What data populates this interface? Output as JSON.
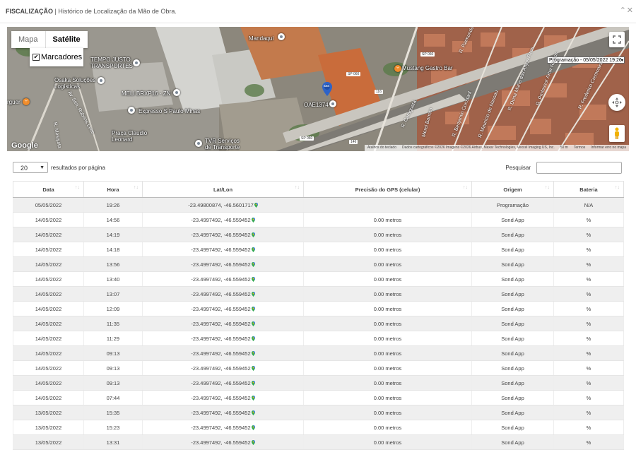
{
  "title": {
    "module": "FISCALIZAÇÃO",
    "separator": " | ",
    "subtitle": "Histórico de Localização da Mão de Obra."
  },
  "window": {
    "collapse_glyph": "⌃",
    "close_glyph": "✕"
  },
  "map": {
    "type_buttons": {
      "map": "Mapa",
      "satellite": "Satélite"
    },
    "markers_label": "Marcadores",
    "markers_checked": "✔",
    "select_value": "Programação - 05/05/2022 19:26",
    "select_arrow": "▾",
    "pin_label": "SEN",
    "pois": [
      {
        "name": "Mandaqui"
      },
      {
        "name": "TEMPO JUSTO\nTRANSPORTES"
      },
      {
        "name": "Osaka Soluções\nLogísticas"
      },
      {
        "name": "MELI BRXP16 - ZN"
      },
      {
        "name": "Expresso S Paulo Minas"
      },
      {
        "name": "Praça Claudio\nLeonard"
      },
      {
        "name": "TVR Serviços\nde Transporte"
      },
      {
        "name": "OAE1374"
      },
      {
        "name": "Mustang Gastro Bar"
      },
      {
        "name": "rguer"
      }
    ],
    "streets": [
      "R. Mesquita",
      "Av. Sen. Rubens Leite",
      "R. Caraguatá",
      "R. Benjamin Constant",
      "R. Mauricio de Nassau",
      "R. Dona Maria dos Anjos Pires",
      "R. Professor Artur Ramos",
      "R. Frederico Cremonini",
      "Merei Barreto",
      "R. Raimundo Ro"
    ],
    "shields": [
      "SP 060",
      "SP 060",
      "116",
      "146",
      "SP 060"
    ],
    "google": "Google",
    "attribution": [
      "Atalhos do teclado",
      "Dados cartográficos ©2026 Imagens ©2026 Airbus, Maxar Technologies, Vexcel Imaging US, Inc.",
      "50 m",
      "Termos",
      "Informar erro no mapa"
    ],
    "icons": {
      "fullscreen": "fullscreen-icon",
      "pan": "pan-control-icon",
      "pegman": "pegman-icon"
    }
  },
  "table_controls": {
    "page_length": "20",
    "page_length_suffix": "resultados por página",
    "search_label": "Pesquisar",
    "sort_glyph": "↑↓"
  },
  "columns": [
    "Data",
    "Hora",
    "Lat/Lon",
    "Precisão do GPS (celular)",
    "Origem",
    "Bateria"
  ],
  "rows": [
    {
      "data": "05/05/2022",
      "hora": "19:26",
      "latlon": "-23.49800874, -46.5601717",
      "gps": "",
      "origem": "Programação",
      "bateria": "N/A"
    },
    {
      "data": "14/05/2022",
      "hora": "14:56",
      "latlon": "-23.4997492, -46.559452",
      "gps": "0.00 metros",
      "origem": "Sond App",
      "bateria": "%"
    },
    {
      "data": "14/05/2022",
      "hora": "14:19",
      "latlon": "-23.4997492, -46.559452",
      "gps": "0.00 metros",
      "origem": "Sond App",
      "bateria": "%"
    },
    {
      "data": "14/05/2022",
      "hora": "14:18",
      "latlon": "-23.4997492, -46.559452",
      "gps": "0.00 metros",
      "origem": "Sond App",
      "bateria": "%"
    },
    {
      "data": "14/05/2022",
      "hora": "13:56",
      "latlon": "-23.4997492, -46.559452",
      "gps": "0.00 metros",
      "origem": "Sond App",
      "bateria": "%"
    },
    {
      "data": "14/05/2022",
      "hora": "13:40",
      "latlon": "-23.4997492, -46.559452",
      "gps": "0.00 metros",
      "origem": "Sond App",
      "bateria": "%"
    },
    {
      "data": "14/05/2022",
      "hora": "13:07",
      "latlon": "-23.4997492, -46.559452",
      "gps": "0.00 metros",
      "origem": "Sond App",
      "bateria": "%"
    },
    {
      "data": "14/05/2022",
      "hora": "12:09",
      "latlon": "-23.4997492, -46.559452",
      "gps": "0.00 metros",
      "origem": "Sond App",
      "bateria": "%"
    },
    {
      "data": "14/05/2022",
      "hora": "11:35",
      "latlon": "-23.4997492, -46.559452",
      "gps": "0.00 metros",
      "origem": "Sond App",
      "bateria": "%"
    },
    {
      "data": "14/05/2022",
      "hora": "11:29",
      "latlon": "-23.4997492, -46.559452",
      "gps": "0.00 metros",
      "origem": "Sond App",
      "bateria": "%"
    },
    {
      "data": "14/05/2022",
      "hora": "09:13",
      "latlon": "-23.4997492, -46.559452",
      "gps": "0.00 metros",
      "origem": "Sond App",
      "bateria": "%"
    },
    {
      "data": "14/05/2022",
      "hora": "09:13",
      "latlon": "-23.4997492, -46.559452",
      "gps": "0.00 metros",
      "origem": "Sond App",
      "bateria": "%"
    },
    {
      "data": "14/05/2022",
      "hora": "09:13",
      "latlon": "-23.4997492, -46.559452",
      "gps": "0.00 metros",
      "origem": "Sond App",
      "bateria": "%"
    },
    {
      "data": "14/05/2022",
      "hora": "07:44",
      "latlon": "-23.4997492, -46.559452",
      "gps": "0.00 metros",
      "origem": "Sond App",
      "bateria": "%"
    },
    {
      "data": "13/05/2022",
      "hora": "15:35",
      "latlon": "-23.4997492, -46.559452",
      "gps": "0.00 metros",
      "origem": "Sond App",
      "bateria": "%"
    },
    {
      "data": "13/05/2022",
      "hora": "15:23",
      "latlon": "-23.4997492, -46.559452",
      "gps": "0.00 metros",
      "origem": "Sond App",
      "bateria": "%"
    },
    {
      "data": "13/05/2022",
      "hora": "13:31",
      "latlon": "-23.4997492, -46.559452",
      "gps": "0.00 metros",
      "origem": "Sond App",
      "bateria": "%"
    }
  ],
  "colors": {
    "row_odd": "#efefef",
    "row_even": "#ffffff",
    "pin_blue": "#2d63c8",
    "gps_pin_green": "#34a853"
  }
}
